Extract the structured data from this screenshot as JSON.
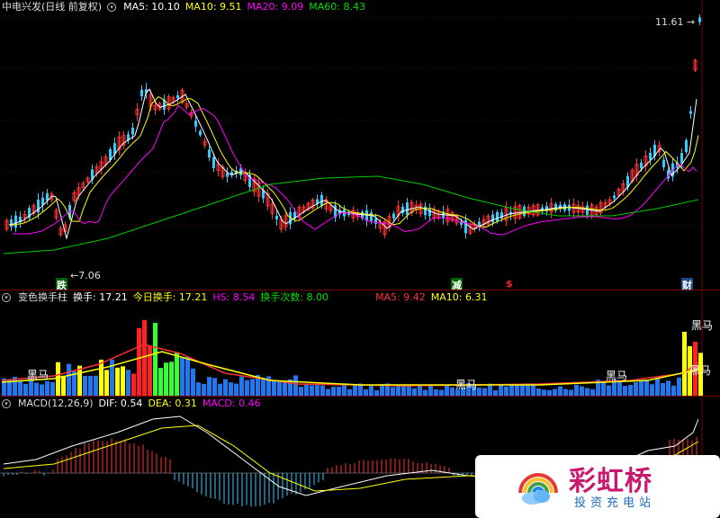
{
  "main_header": {
    "title": "中电兴发(日线 前复权)",
    "ma5": "MA5: 10.10",
    "ma10": "MA10: 9.51",
    "ma20": "MA20: 9.09",
    "ma60": "MA60: 8.43"
  },
  "main_chart": {
    "price_high_label": "11.61",
    "price_low_label": "7.06",
    "event_markers": [
      {
        "text": "跌",
        "color": "#ffffff",
        "bg": "#006400"
      },
      {
        "text": "减",
        "color": "#ffffff",
        "bg": "#006400"
      },
      {
        "text": "$",
        "color": "#ff2020",
        "bg": "transparent"
      },
      {
        "text": "财",
        "color": "#ffffff",
        "bg": "#1e4a8a"
      }
    ]
  },
  "volume_header": {
    "title": "变色换手柱",
    "turnover": "换手: 17.21",
    "today_turnover": "今日换手: 17.21",
    "hs": "HS: 8.54",
    "turnover_count": "换手次数: 8.00",
    "ma5": "MA5: 9.42",
    "ma10": "MA10: 6.31"
  },
  "volume_chart": {
    "labels": [
      "黑马",
      "黑马",
      "黑马",
      "黑马",
      "黑马"
    ]
  },
  "macd_header": {
    "title": "MACD(12,26,9)",
    "dif": "DIF: 0.54",
    "dea": "DEA: 0.31",
    "macd": "MACD: 0.46"
  },
  "watermark": {
    "title": "彩虹桥",
    "subtitle": "投资充电站"
  },
  "colors": {
    "up": "#ff3333",
    "down": "#33ccff",
    "ma5": "#ffffff",
    "ma10": "#ffff00",
    "ma20": "#ff00ff",
    "ma60": "#00cc00"
  }
}
